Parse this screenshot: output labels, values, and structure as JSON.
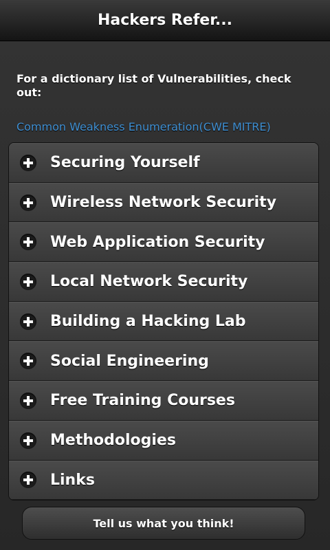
{
  "header": {
    "title": "Hackers Refer..."
  },
  "intro": {
    "text": "For a dictionary list of Vulnerabilities, check out:",
    "link": "Common Weakness Enumeration(CWE MITRE)"
  },
  "sections": [
    {
      "label": "Securing Yourself",
      "icon": "plus-icon"
    },
    {
      "label": "Wireless Network Security",
      "icon": "plus-icon"
    },
    {
      "label": "Web Application Security",
      "icon": "plus-icon"
    },
    {
      "label": "Local Network Security",
      "icon": "plus-icon"
    },
    {
      "label": "Building a Hacking Lab",
      "icon": "plus-icon"
    },
    {
      "label": "Social Engineering",
      "icon": "plus-icon"
    },
    {
      "label": "Free Training Courses",
      "icon": "plus-icon"
    },
    {
      "label": "Methodologies",
      "icon": "plus-icon"
    },
    {
      "label": "Links",
      "icon": "plus-icon"
    }
  ],
  "feedback": {
    "label": "Tell us what you think!"
  },
  "colors": {
    "link": "#3f8fd2",
    "background": "#2b2b2b",
    "text": "#ffffff"
  }
}
